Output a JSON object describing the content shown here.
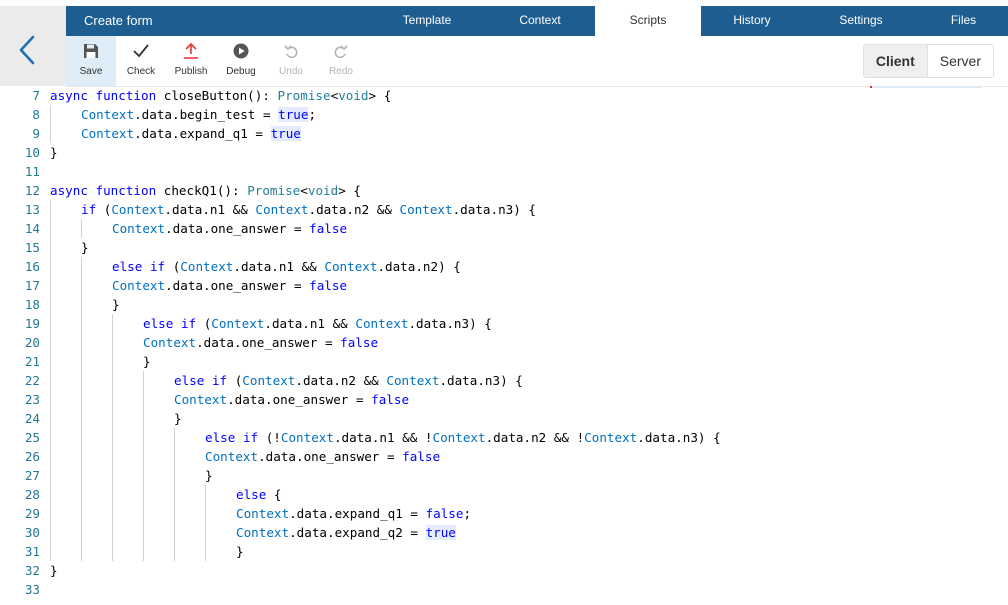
{
  "header": {
    "title": "Create form",
    "tabs": [
      "Template",
      "Context",
      "Scripts",
      "History",
      "Settings",
      "Files"
    ],
    "active_tab": "Scripts"
  },
  "toolbar": {
    "save": "Save",
    "check": "Check",
    "publish": "Publish",
    "debug": "Debug",
    "undo": "Undo",
    "redo": "Redo"
  },
  "mode": {
    "client": "Client",
    "server": "Server",
    "active": "Client"
  },
  "colors": {
    "header_bg": "#1e5d90",
    "keyword": "#0000ff",
    "type": "#267f99",
    "identifier": "#0070c1",
    "line_number": "#237893",
    "active_tool_bg": "#deedf7"
  },
  "editor": {
    "lines": [
      {
        "n": "7",
        "indent": 0,
        "segs": [
          [
            "k",
            "async"
          ],
          [
            "p",
            " "
          ],
          [
            "k",
            "function"
          ],
          [
            "p",
            " closeButton(): "
          ],
          [
            "t",
            "Promise"
          ],
          [
            "p",
            "<"
          ],
          [
            "t",
            "void"
          ],
          [
            "p",
            "> {"
          ]
        ]
      },
      {
        "n": "8",
        "indent": 1,
        "segs": [
          [
            "c",
            "Context"
          ],
          [
            "p",
            ".data.begin_test = "
          ],
          [
            "kh",
            "true"
          ],
          [
            "p",
            ";"
          ]
        ]
      },
      {
        "n": "9",
        "indent": 1,
        "segs": [
          [
            "c",
            "Context"
          ],
          [
            "p",
            ".data.expand_q1 = "
          ],
          [
            "kh",
            "true"
          ]
        ]
      },
      {
        "n": "10",
        "indent": 0,
        "segs": [
          [
            "p",
            "}"
          ]
        ]
      },
      {
        "n": "11",
        "indent": 0,
        "segs": []
      },
      {
        "n": "12",
        "indent": 0,
        "segs": [
          [
            "k",
            "async"
          ],
          [
            "p",
            " "
          ],
          [
            "k",
            "function"
          ],
          [
            "p",
            " checkQ1(): "
          ],
          [
            "t",
            "Promise"
          ],
          [
            "p",
            "<"
          ],
          [
            "t",
            "void"
          ],
          [
            "p",
            "> {"
          ]
        ]
      },
      {
        "n": "13",
        "indent": 1,
        "segs": [
          [
            "k",
            "if"
          ],
          [
            "p",
            " ("
          ],
          [
            "c",
            "Context"
          ],
          [
            "p",
            ".data.n1 && "
          ],
          [
            "c",
            "Context"
          ],
          [
            "p",
            ".data.n2 && "
          ],
          [
            "c",
            "Context"
          ],
          [
            "p",
            ".data.n3) {"
          ]
        ]
      },
      {
        "n": "14",
        "indent": 2,
        "segs": [
          [
            "c",
            "Context"
          ],
          [
            "p",
            ".data.one_answer = "
          ],
          [
            "k",
            "false"
          ]
        ]
      },
      {
        "n": "15",
        "indent": 1,
        "segs": [
          [
            "p",
            "}"
          ]
        ]
      },
      {
        "n": "16",
        "indent": 2,
        "segs": [
          [
            "k",
            "else"
          ],
          [
            "p",
            " "
          ],
          [
            "k",
            "if"
          ],
          [
            "p",
            " ("
          ],
          [
            "c",
            "Context"
          ],
          [
            "p",
            ".data.n1 && "
          ],
          [
            "c",
            "Context"
          ],
          [
            "p",
            ".data.n2) {"
          ]
        ]
      },
      {
        "n": "17",
        "indent": 2,
        "segs": [
          [
            "c",
            "Context"
          ],
          [
            "p",
            ".data.one_answer = "
          ],
          [
            "k",
            "false"
          ]
        ]
      },
      {
        "n": "18",
        "indent": 2,
        "segs": [
          [
            "p",
            "}"
          ]
        ]
      },
      {
        "n": "19",
        "indent": 3,
        "segs": [
          [
            "k",
            "else"
          ],
          [
            "p",
            " "
          ],
          [
            "k",
            "if"
          ],
          [
            "p",
            " ("
          ],
          [
            "c",
            "Context"
          ],
          [
            "p",
            ".data.n1 && "
          ],
          [
            "c",
            "Context"
          ],
          [
            "p",
            ".data.n3) {"
          ]
        ]
      },
      {
        "n": "20",
        "indent": 3,
        "segs": [
          [
            "c",
            "Context"
          ],
          [
            "p",
            ".data.one_answer = "
          ],
          [
            "k",
            "false"
          ]
        ]
      },
      {
        "n": "21",
        "indent": 3,
        "segs": [
          [
            "p",
            "}"
          ]
        ]
      },
      {
        "n": "22",
        "indent": 4,
        "segs": [
          [
            "k",
            "else"
          ],
          [
            "p",
            " "
          ],
          [
            "k",
            "if"
          ],
          [
            "p",
            " ("
          ],
          [
            "c",
            "Context"
          ],
          [
            "p",
            ".data.n2 && "
          ],
          [
            "c",
            "Context"
          ],
          [
            "p",
            ".data.n3) {"
          ]
        ]
      },
      {
        "n": "23",
        "indent": 4,
        "segs": [
          [
            "c",
            "Context"
          ],
          [
            "p",
            ".data.one_answer = "
          ],
          [
            "k",
            "false"
          ]
        ]
      },
      {
        "n": "24",
        "indent": 4,
        "segs": [
          [
            "p",
            "}"
          ]
        ]
      },
      {
        "n": "25",
        "indent": 5,
        "segs": [
          [
            "k",
            "else"
          ],
          [
            "p",
            " "
          ],
          [
            "k",
            "if"
          ],
          [
            "p",
            " (!"
          ],
          [
            "c",
            "Context"
          ],
          [
            "p",
            ".data.n1 && !"
          ],
          [
            "c",
            "Context"
          ],
          [
            "p",
            ".data.n2 && !"
          ],
          [
            "c",
            "Context"
          ],
          [
            "p",
            ".data.n3) {"
          ]
        ]
      },
      {
        "n": "26",
        "indent": 5,
        "segs": [
          [
            "c",
            "Context"
          ],
          [
            "p",
            ".data.one_answer = "
          ],
          [
            "k",
            "false"
          ]
        ]
      },
      {
        "n": "27",
        "indent": 5,
        "segs": [
          [
            "p",
            "}"
          ]
        ]
      },
      {
        "n": "28",
        "indent": 6,
        "segs": [
          [
            "k",
            "else"
          ],
          [
            "p",
            " {"
          ]
        ]
      },
      {
        "n": "29",
        "indent": 6,
        "segs": [
          [
            "c",
            "Context"
          ],
          [
            "p",
            ".data.expand_q1 = "
          ],
          [
            "k",
            "false"
          ],
          [
            "p",
            ";"
          ]
        ]
      },
      {
        "n": "30",
        "indent": 6,
        "segs": [
          [
            "c",
            "Context"
          ],
          [
            "p",
            ".data.expand_q2 = "
          ],
          [
            "kh",
            "true"
          ]
        ]
      },
      {
        "n": "31",
        "indent": 6,
        "segs": [
          [
            "p",
            "}"
          ]
        ]
      },
      {
        "n": "32",
        "indent": 0,
        "segs": [
          [
            "p",
            "}"
          ]
        ]
      },
      {
        "n": "33",
        "indent": 0,
        "segs": []
      }
    ]
  }
}
